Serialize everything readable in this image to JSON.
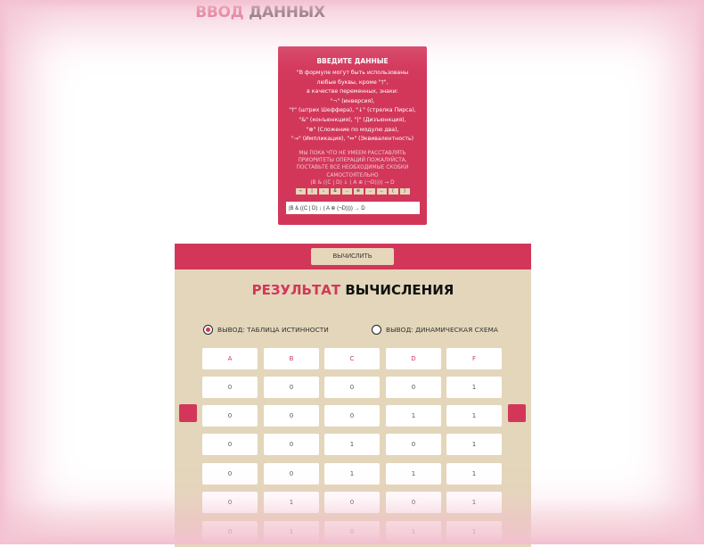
{
  "page": {
    "title_accent": "ВВОД",
    "title_rest": "ДАННЫХ"
  },
  "input_card": {
    "title": "ВВЕДИТЕ ДАННЫЕ",
    "hint_lines": [
      "\"В формуле могут быть использованы",
      "любые буквы, кроме \"†\",",
      "в качестве переменных, знаки:",
      "\"¬\" (инверсия),",
      "\"†\" (штрих Шеффера), \"↓\" (стрелка Пирса),",
      "\"&\" (конъюнкция), \"|\" (Дизъюнкция),",
      "\"⊕\" (Сложение по модулю два),",
      "\"→\" (Импликация), \"⇔\" (Эквивалентность)"
    ],
    "warning_lines": [
      "МЫ ПОКА ЧТО НЕ УМЕЕМ РАССТАВЛЯТЬ",
      "ПРИОРИТЕТЫ ОПЕРАЦИЙ ПОЖАЛУЙСТА,",
      "ПОСТАВЬТЕ ВСЕ НЕОБХОДИМЫЕ СКОБКИ",
      "САМОСТОЯТЕЛЬНО",
      "(B & ((C | D) ↓ ( A ⊕ (¬D)))) → D"
    ],
    "operator_buttons": [
      "¬",
      "|",
      "↓",
      "&",
      "→",
      "⊕",
      "→",
      "↔",
      "(",
      ")"
    ],
    "formula_value": "(B & ((C | D) ↓ ( A ⊕ (¬D)))) → D"
  },
  "result": {
    "calc_button": "ВЫЧИСЛИТЬ",
    "title_accent": "РЕЗУЛЬТАТ",
    "title_rest": "ВЫЧИСЛЕНИЯ",
    "radio_truth_table": "ВЫВОД: ТАБЛИЦА ИСТИННОСТИ",
    "radio_dynamic_scheme": "ВЫВОД: ДИНАМИЧЕСКАЯ СХЕМА",
    "selected_output": "truth_table",
    "columns": [
      "A",
      "B",
      "C",
      "D",
      "F"
    ],
    "rows": [
      [
        "0",
        "0",
        "0",
        "0",
        "1"
      ],
      [
        "0",
        "0",
        "0",
        "1",
        "1"
      ],
      [
        "0",
        "0",
        "1",
        "0",
        "1"
      ],
      [
        "0",
        "0",
        "1",
        "1",
        "1"
      ],
      [
        "0",
        "1",
        "0",
        "0",
        "1"
      ],
      [
        "0",
        "1",
        "0",
        "1",
        "1"
      ]
    ]
  },
  "colors": {
    "accent": "#d2375a",
    "panel": "#e3d6ba",
    "button": "#e6d6ba"
  }
}
